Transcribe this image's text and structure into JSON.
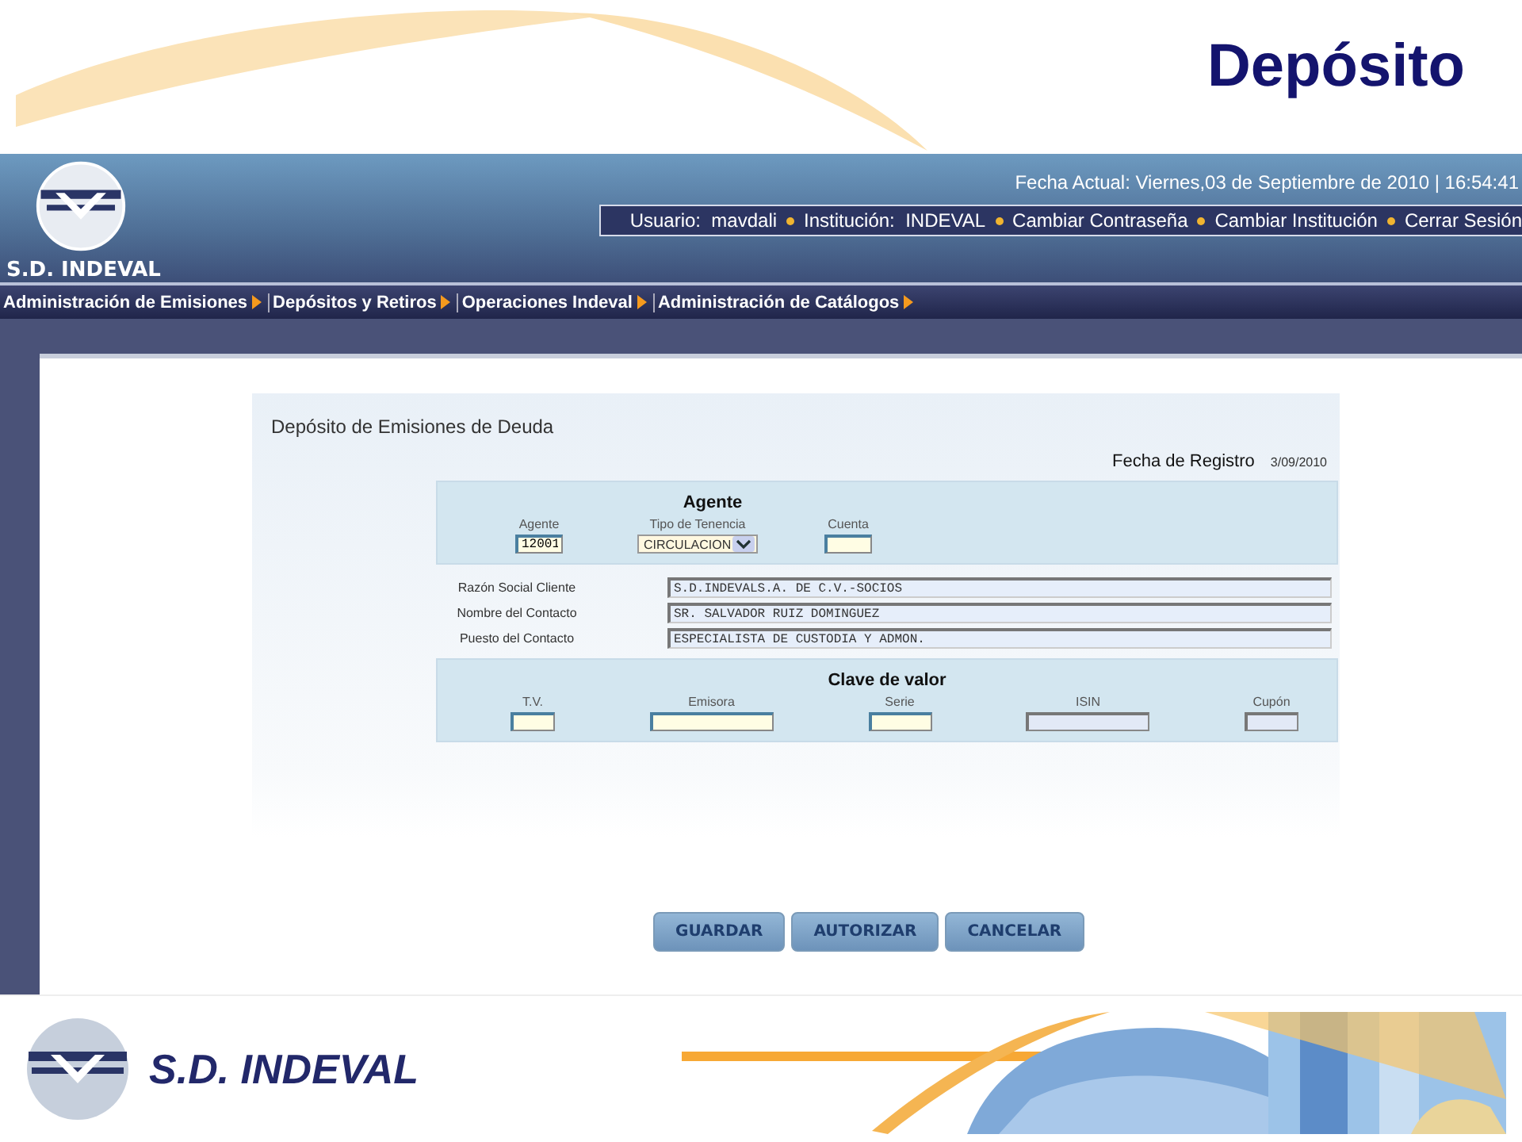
{
  "slide": {
    "title": "Depósito"
  },
  "header": {
    "brand": "S.D. INDEVAL",
    "date_line": "Fecha Actual: Viernes,03 de Septiembre de 2010 | 16:54:41",
    "user_bar": [
      "Usuario:  mavdali",
      "Institución:  INDEVAL",
      "Cambiar Contraseña",
      "Cambiar Institución",
      "Cerrar Sesión"
    ]
  },
  "menu": [
    "Administración de Emisiones",
    "Depósitos y Retiros",
    "Operaciones Indeval",
    "Administración de Catálogos"
  ],
  "form": {
    "title": "Depósito de Emisiones de Deuda",
    "registro_label": "Fecha de Registro",
    "registro_value": "3/09/2010",
    "agente": {
      "title": "Agente",
      "fields": [
        {
          "label": "Agente",
          "kind": "text",
          "value": "12001"
        },
        {
          "label": "Tipo de Tenencia",
          "kind": "select",
          "value": "CIRCULACION"
        },
        {
          "label": "Cuenta",
          "kind": "text"
        }
      ]
    },
    "contact": [
      {
        "label": "Razón Social Cliente",
        "value": "S.D.INDEVALS.A. DE C.V.-SOCIOS"
      },
      {
        "label": "Nombre del Contacto",
        "value": "SR. SALVADOR RUIZ DOMINGUEZ"
      },
      {
        "label": "Puesto del Contacto",
        "value": "ESPECIALISTA DE CUSTODIA Y ADMON."
      }
    ],
    "clave": {
      "title": "Clave de valor",
      "fields": [
        {
          "label": "T.V.",
          "disabled": false
        },
        {
          "label": "Emisora",
          "disabled": false
        },
        {
          "label": "Serie",
          "disabled": false
        },
        {
          "label": "ISIN",
          "disabled": true
        },
        {
          "label": "Cupón",
          "disabled": true
        }
      ]
    }
  },
  "buttons": [
    "GUARDAR",
    "AUTORIZAR",
    "CANCELAR"
  ],
  "footer": {
    "brand": "S.D. INDEVAL"
  }
}
